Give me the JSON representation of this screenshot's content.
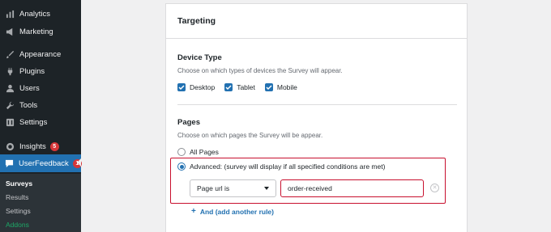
{
  "sidebar": {
    "items": [
      {
        "label": "Analytics",
        "icon": "analytics-icon"
      },
      {
        "label": "Marketing",
        "icon": "megaphone-icon"
      },
      {
        "label": "Appearance",
        "icon": "paintbrush-icon"
      },
      {
        "label": "Plugins",
        "icon": "plug-icon"
      },
      {
        "label": "Users",
        "icon": "user-icon"
      },
      {
        "label": "Tools",
        "icon": "wrench-icon"
      },
      {
        "label": "Settings",
        "icon": "settings-sliders-icon"
      },
      {
        "label": "Insights",
        "icon": "insights-icon",
        "badge": "5"
      },
      {
        "label": "UserFeedback",
        "icon": "userfeedback-icon",
        "badge": "1"
      }
    ],
    "submenu": [
      {
        "label": "Surveys"
      },
      {
        "label": "Results"
      },
      {
        "label": "Settings"
      },
      {
        "label": "Addons"
      }
    ],
    "active_color": "#2271b1",
    "addons_color": "#1da867"
  },
  "card": {
    "title": "Targeting",
    "device": {
      "title": "Device Type",
      "description": "Choose on which types of devices the Survey will appear.",
      "options": [
        {
          "label": "Desktop",
          "checked": true
        },
        {
          "label": "Tablet",
          "checked": true
        },
        {
          "label": "Mobile",
          "checked": true
        }
      ]
    },
    "pages": {
      "title": "Pages",
      "description": "Choose on which pages the Survey will be appear.",
      "all_pages_label": "All Pages",
      "advanced_label": "Advanced: (survey will display if all specified conditions are met)",
      "selected": "advanced",
      "rule": {
        "condition": "Page url is",
        "value": "order-received"
      },
      "add_rule_label": "And (add another rule)"
    }
  },
  "highlight_color": "#c8102e"
}
